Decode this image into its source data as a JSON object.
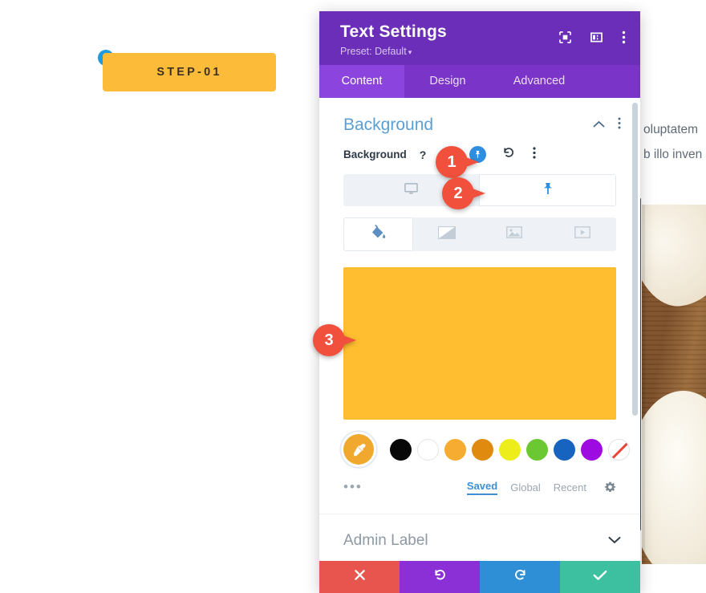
{
  "page": {
    "step_badge_label": "STEP-01",
    "right_text_line1": "oluptatem",
    "right_text_line2": "b illo inven",
    "step_badge_color": "#FCBC3A",
    "step_bullet_color": "#1C9BE0"
  },
  "modal": {
    "title": "Text Settings",
    "preset_label": "Preset: Default",
    "preset_caret": "▾",
    "header_color": "#6B2EB8",
    "header_icons": [
      {
        "name": "fullscreen-icon",
        "label": "Expand"
      },
      {
        "name": "layout-panel-icon",
        "label": "Dock"
      },
      {
        "name": "more-vertical-icon",
        "label": "More"
      }
    ],
    "tabs": [
      {
        "label": "Content",
        "active": true
      },
      {
        "label": "Design",
        "active": false
      },
      {
        "label": "Advanced",
        "active": false
      }
    ]
  },
  "background_section": {
    "title": "Background",
    "collapse_icon": "chevron-up-icon",
    "menu_icon": "more-vertical-icon",
    "field_label": "Background",
    "help_label": "?",
    "pin_badge_color": "#2E8FE0",
    "reset_icon": "reset-icon",
    "options_icon": "more-vertical-icon",
    "responsive_tabs": [
      {
        "name": "desktop-view",
        "icon": "monitor-icon",
        "active": false
      },
      {
        "name": "pinned-view",
        "icon": "pin-icon",
        "active": true
      }
    ],
    "bg_type_tabs": [
      {
        "name": "background-color",
        "icon": "paint-bucket-icon",
        "active": true
      },
      {
        "name": "background-gradient",
        "icon": "gradient-icon",
        "active": false
      },
      {
        "name": "background-image",
        "icon": "image-icon",
        "active": false
      },
      {
        "name": "background-video",
        "icon": "video-icon",
        "active": false
      }
    ],
    "preview_color": "#FEBE2F",
    "eyedropper": {
      "name": "eyedropper-icon",
      "color": "#F0A92E"
    },
    "swatches": [
      {
        "name": "swatch-black",
        "color": "#080808"
      },
      {
        "name": "swatch-white",
        "color": "#FFFFFF"
      },
      {
        "name": "swatch-amber",
        "color": "#F5AC31"
      },
      {
        "name": "swatch-orange",
        "color": "#E08A10"
      },
      {
        "name": "swatch-yellow",
        "color": "#EDED1B"
      },
      {
        "name": "swatch-green",
        "color": "#6CC832"
      },
      {
        "name": "swatch-blue",
        "color": "#1664C0"
      },
      {
        "name": "swatch-purple",
        "color": "#9E0BE0"
      },
      {
        "name": "swatch-none",
        "color": "transparent"
      }
    ],
    "more_colors_label": "•••",
    "palette_links": [
      {
        "label": "Saved",
        "active": true
      },
      {
        "label": "Global",
        "active": false
      },
      {
        "label": "Recent",
        "active": false
      }
    ],
    "settings_icon": "gear-icon"
  },
  "admin_section": {
    "label": "Admin Label",
    "expand_icon": "chevron-down-icon"
  },
  "footer_buttons": [
    {
      "name": "cancel-button",
      "icon": "close-icon",
      "color": "#E8554E"
    },
    {
      "name": "undo-button",
      "icon": "undo-icon",
      "color": "#8B2FD6"
    },
    {
      "name": "redo-button",
      "icon": "redo-icon",
      "color": "#2E8FD6"
    },
    {
      "name": "save-button",
      "icon": "check-icon",
      "color": "#3DC0A0"
    }
  ],
  "callouts": [
    {
      "number": "1",
      "color": "#F0503C"
    },
    {
      "number": "2",
      "color": "#F0503C"
    },
    {
      "number": "3",
      "color": "#F0503C"
    }
  ]
}
